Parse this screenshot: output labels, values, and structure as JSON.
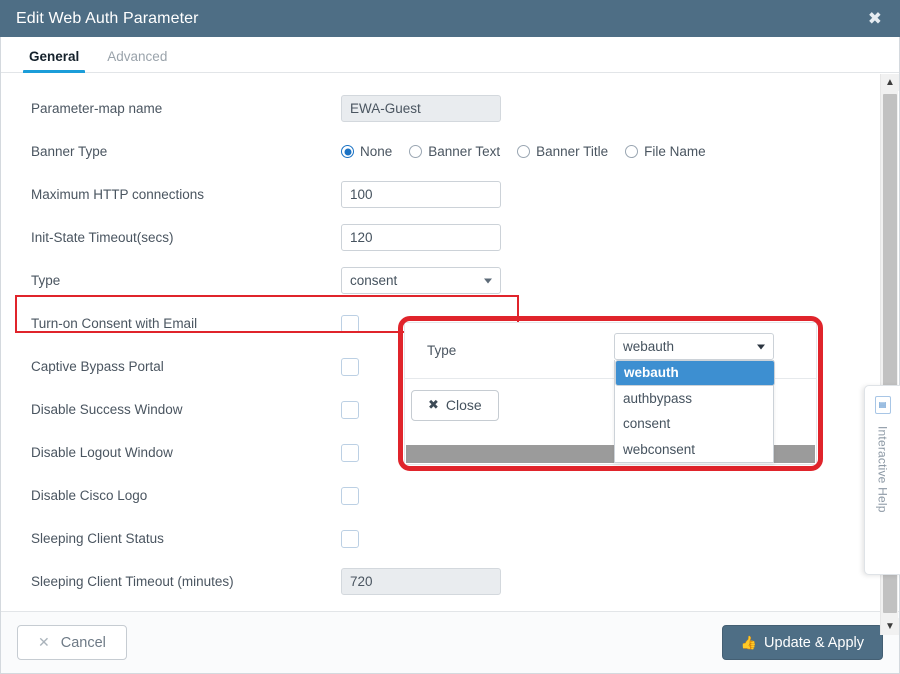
{
  "window": {
    "title": "Edit Web Auth Parameter",
    "close_icon": "close-icon",
    "titlebar_color": "#4e6e85"
  },
  "tabs": [
    {
      "label": "General",
      "active": true
    },
    {
      "label": "Advanced",
      "active": false
    }
  ],
  "form": {
    "parameter_map_name": {
      "label": "Parameter-map name",
      "value": "EWA-Guest",
      "readonly": true
    },
    "banner_type": {
      "label": "Banner Type",
      "options": [
        "None",
        "Banner Text",
        "Banner Title",
        "File Name"
      ],
      "selected": "None"
    },
    "max_http_connections": {
      "label": "Maximum HTTP connections",
      "value": "100"
    },
    "init_state_timeout": {
      "label": "Init-State Timeout(secs)",
      "value": "120"
    },
    "type": {
      "label": "Type",
      "value": "consent",
      "highlighted": true
    },
    "checkboxes": [
      {
        "label": "Turn-on Consent with Email",
        "checked": false
      },
      {
        "label": "Captive Bypass Portal",
        "checked": false
      },
      {
        "label": "Disable Success Window",
        "checked": false
      },
      {
        "label": "Disable Logout Window",
        "checked": false
      },
      {
        "label": "Disable Cisco Logo",
        "checked": false
      },
      {
        "label": "Sleeping Client Status",
        "checked": false
      }
    ],
    "sleeping_client_timeout": {
      "label": "Sleeping Client Timeout (minutes)",
      "value": "720",
      "readonly": true
    }
  },
  "popup": {
    "type_label": "Type",
    "dropdown": {
      "value": "webauth",
      "caret_icon": "chevron-down-icon",
      "options": [
        "webauth",
        "authbypass",
        "consent",
        "webconsent"
      ],
      "highlighted_option": "webauth",
      "highlight_color": "#3d8fd1"
    },
    "close_button": {
      "label": "Close",
      "icon": "x-icon"
    },
    "outline_color": "#e0242b"
  },
  "interactive_help": {
    "label": "Interactive Help",
    "icon": "help-panel-icon"
  },
  "scrollbar": {
    "up_icon": "chevron-up-icon",
    "down_icon": "chevron-down-icon"
  },
  "footer": {
    "cancel": {
      "label": "Cancel",
      "icon": "x-icon"
    },
    "apply": {
      "label": "Update & Apply",
      "icon": "thumbs-up-icon",
      "color": "#4e6e85"
    }
  }
}
